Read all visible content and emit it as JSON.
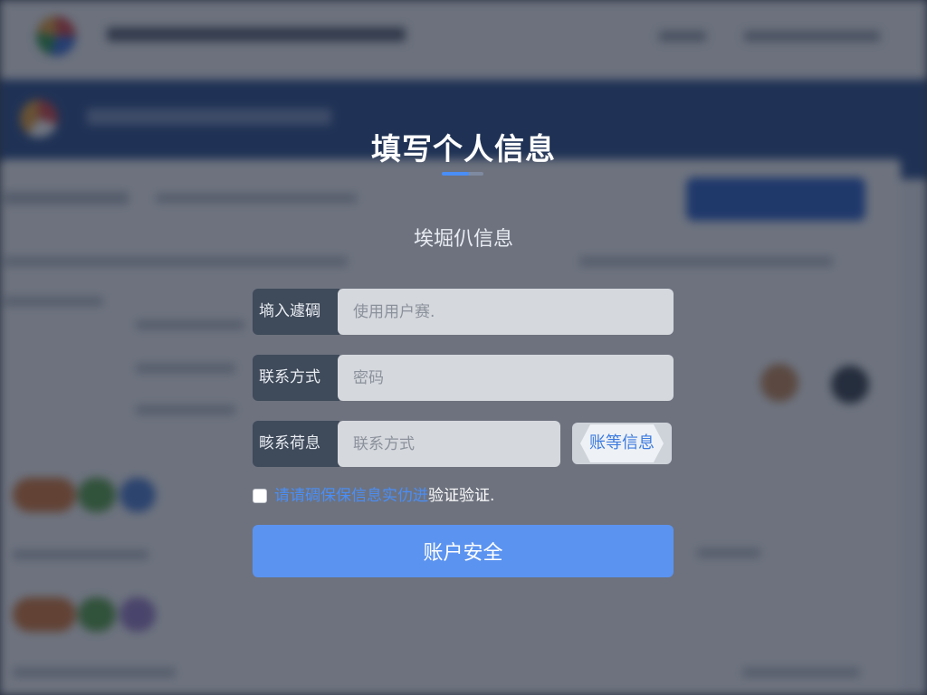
{
  "modal": {
    "title": "填写个人信息",
    "subtitle": "埃堀仈信息",
    "fields": [
      {
        "label": "墒入遽碉",
        "placeholder": "使用用户赛.",
        "value": ""
      },
      {
        "label": "联系方式",
        "placeholder": "密码",
        "value": ""
      },
      {
        "label": "畡系荷息",
        "placeholder": "联系方式",
        "value": ""
      }
    ],
    "side_button_label": "账等信息",
    "consent": {
      "checked": false,
      "link_text": "请请碉保保信息实仂迸",
      "plain_text": "验证验证."
    },
    "submit_label": "账户安全"
  },
  "colors": {
    "accent": "#5b93f0",
    "link": "#4a8ef7",
    "overlay": "#182132",
    "background_banner": "#2c4f8f"
  }
}
